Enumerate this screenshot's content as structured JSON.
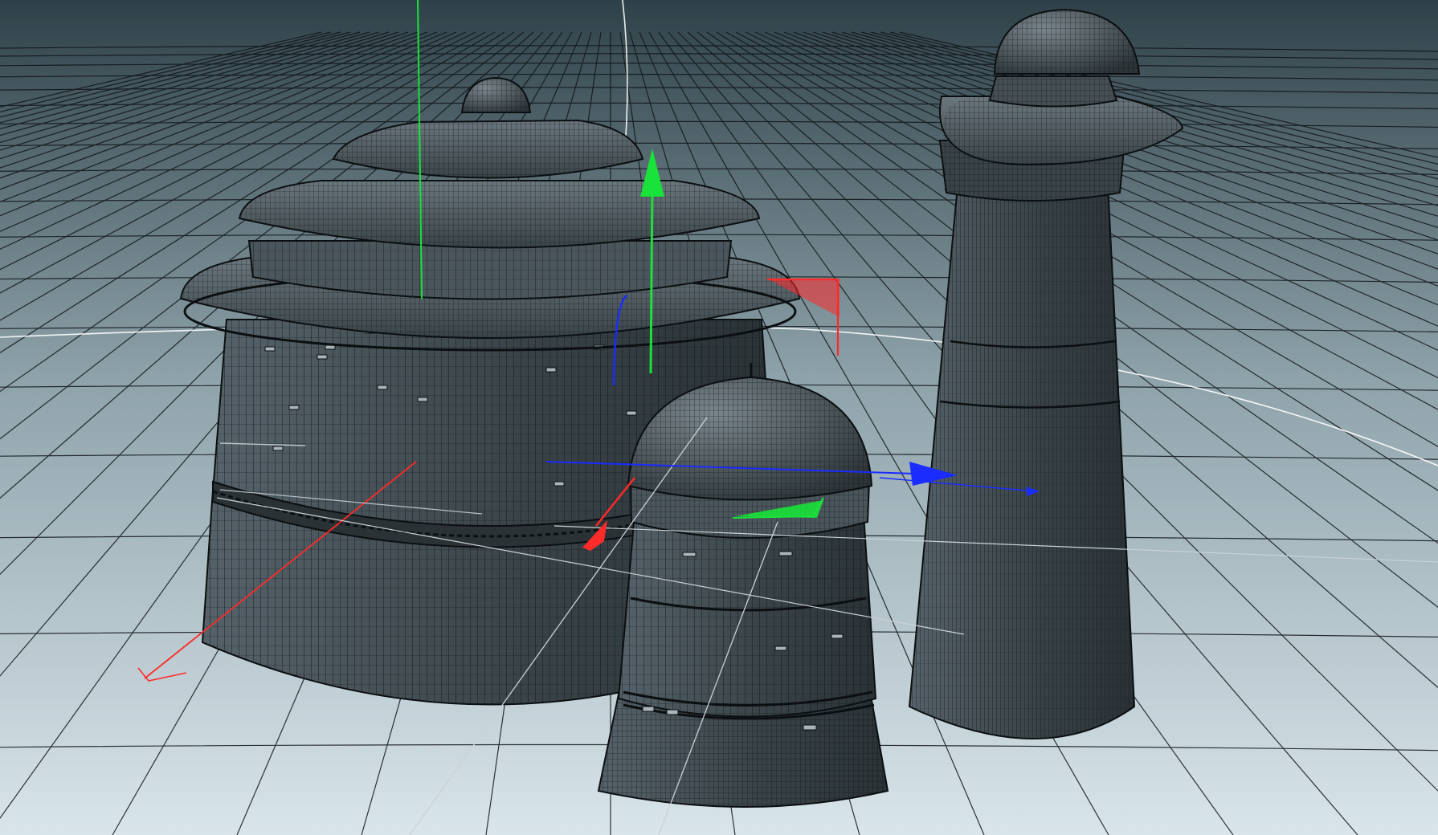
{
  "viewport": {
    "name": "3d-modeling-viewport",
    "background_top": "#2f4148",
    "background_mid": "#8ea2aa",
    "background_bottom": "#d8e5ea",
    "grid_color": "#0e1418",
    "guide_color": "#ffffff",
    "model_fill": "#3a4448",
    "model_fill_light": "#56626a",
    "wire_color": "#0b0f11"
  },
  "gizmo_colors": {
    "x_axis": "#ff2a2a",
    "y_axis": "#19e23a",
    "z_axis": "#1a2cff"
  },
  "objects": [
    {
      "id": "large-tiered-hut",
      "kind": "wireframe-mesh"
    },
    {
      "id": "small-dome-hut",
      "kind": "wireframe-mesh"
    },
    {
      "id": "tall-tower",
      "kind": "wireframe-mesh"
    }
  ],
  "gizmos": [
    {
      "id": "move-gizmo-large-hut",
      "target": "large-tiered-hut"
    },
    {
      "id": "move-gizmo-small-hut",
      "target": "small-dome-hut"
    }
  ]
}
